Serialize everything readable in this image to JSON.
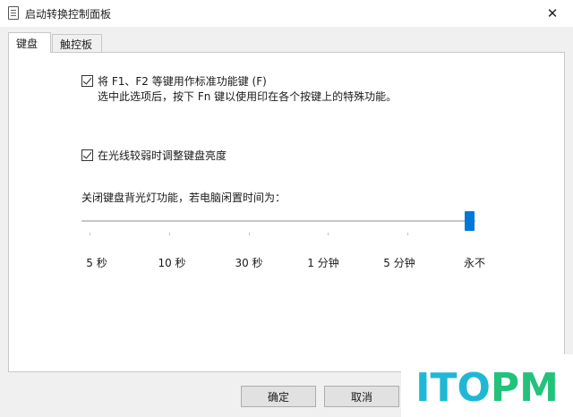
{
  "window": {
    "title": "启动转换控制面板",
    "close_glyph": "✕"
  },
  "tabs": [
    {
      "label": "键盘",
      "active": true
    },
    {
      "label": "触控板",
      "active": false
    }
  ],
  "keyboard": {
    "fn_option": {
      "checked": true,
      "label": "将 F1、F2 等键用作标准功能键 (F)",
      "description": "选中此选项后，按下 Fn 键以使用印在各个按键上的特殊功能。"
    },
    "brightness_option": {
      "checked": true,
      "label": "在光线较弱时调整键盘亮度"
    },
    "backlight": {
      "label": "关闭键盘背光灯功能，若电脑闲置时间为：",
      "selected_index": 5,
      "options": [
        "5 秒",
        "10 秒",
        "30 秒",
        "1 分钟",
        "5 分钟",
        "永不"
      ]
    }
  },
  "buttons": {
    "ok": "确定",
    "cancel": "取消"
  },
  "watermark": {
    "text": "ITOPM",
    "colors": [
      "#1fb8d4",
      "#1fb8d4",
      "#1fb8d4",
      "#23c27a",
      "#23c27a"
    ]
  },
  "colors": {
    "accent": "#0078d7"
  }
}
